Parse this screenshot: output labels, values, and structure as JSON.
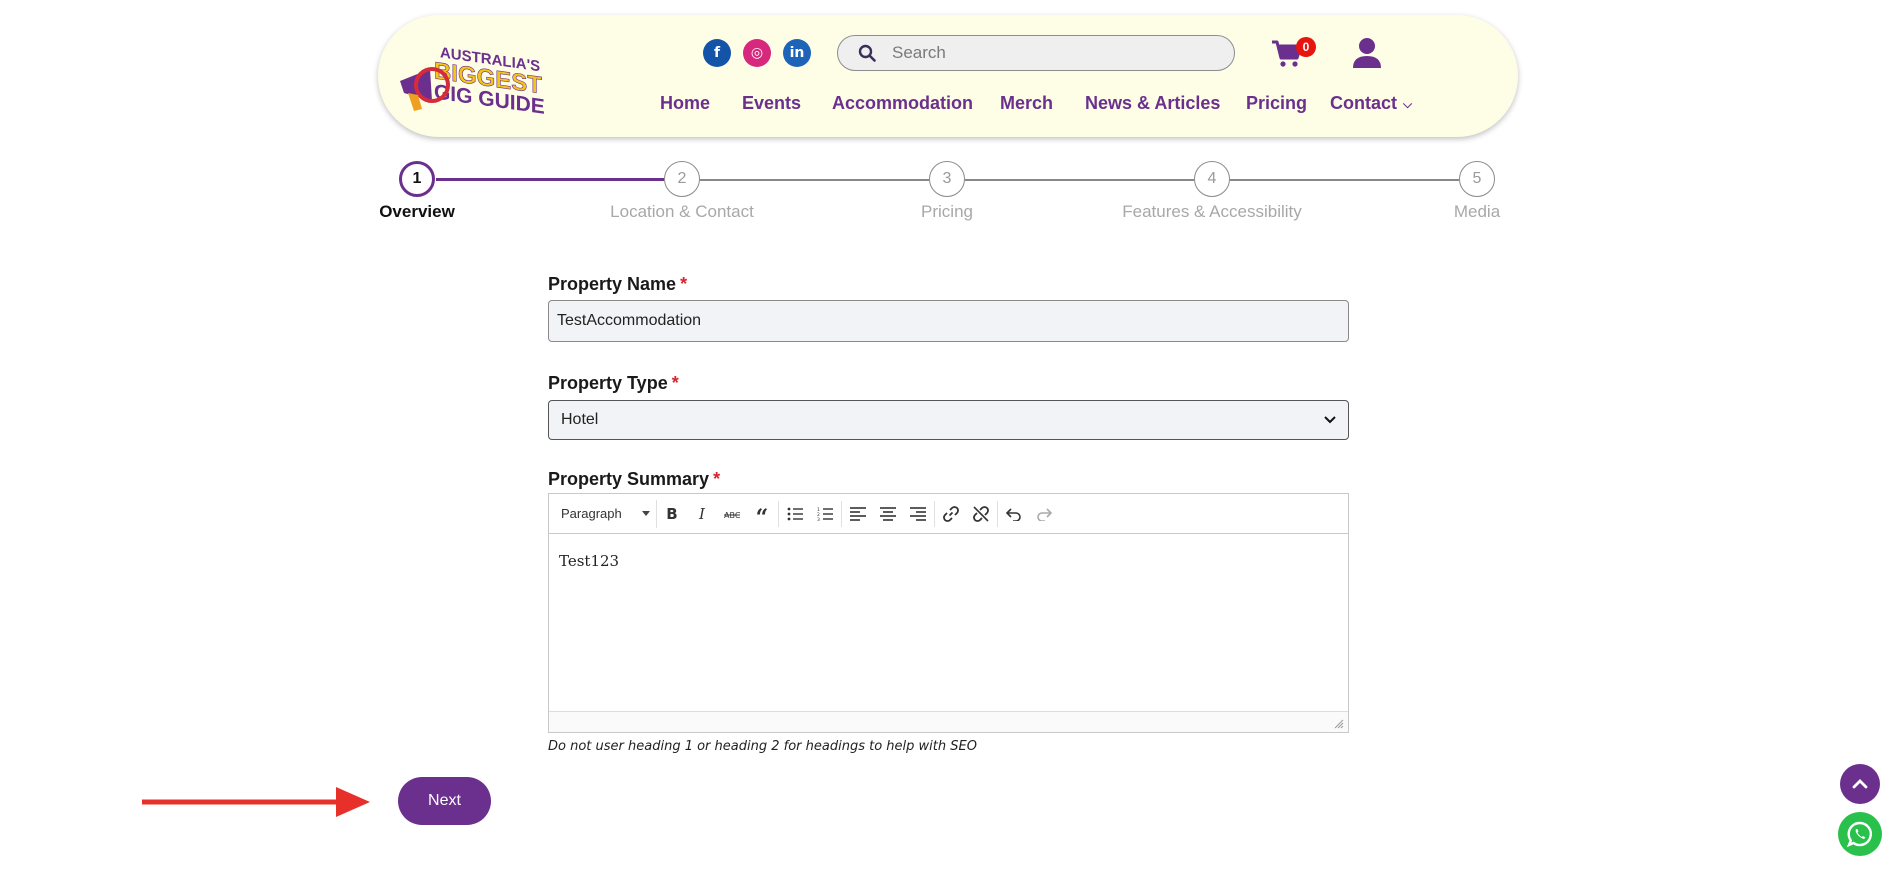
{
  "header": {
    "logo_text": [
      "AUSTRALIA'S",
      "BIGGEST",
      "GIG GUIDE"
    ],
    "social": [
      {
        "name": "facebook-icon",
        "glyph": "f"
      },
      {
        "name": "instagram-icon",
        "glyph": "◎"
      },
      {
        "name": "linkedin-icon",
        "glyph": "in"
      }
    ],
    "search_placeholder": "Search",
    "cart_count": "0",
    "nav": [
      "Home",
      "Events",
      "Accommodation",
      "Merch",
      "News & Articles",
      "Pricing",
      "Contact"
    ]
  },
  "stepper": {
    "current": 1,
    "steps": [
      {
        "number": "1",
        "label": "Overview"
      },
      {
        "number": "2",
        "label": "Location & Contact"
      },
      {
        "number": "3",
        "label": "Pricing"
      },
      {
        "number": "4",
        "label": "Features & Accessibility"
      },
      {
        "number": "5",
        "label": "Media"
      }
    ]
  },
  "form": {
    "property_name": {
      "label": "Property Name",
      "required": "*",
      "value": "TestAccommodation"
    },
    "property_type": {
      "label": "Property Type",
      "required": "*",
      "value": "Hotel"
    },
    "property_summary": {
      "label": "Property Summary",
      "required": "*",
      "format": "Paragraph",
      "content": "Test123",
      "hint": "Do not user heading 1 or heading 2 for headings to help with SEO"
    },
    "next_label": "Next"
  },
  "colors": {
    "brand_purple": "#6b2f8e",
    "header_bg": "#fefee6",
    "required_red": "#d9232f",
    "badge_red": "#e8140f",
    "whatsapp_green": "#29c14b",
    "annotation_arrow": "#e8302b"
  }
}
